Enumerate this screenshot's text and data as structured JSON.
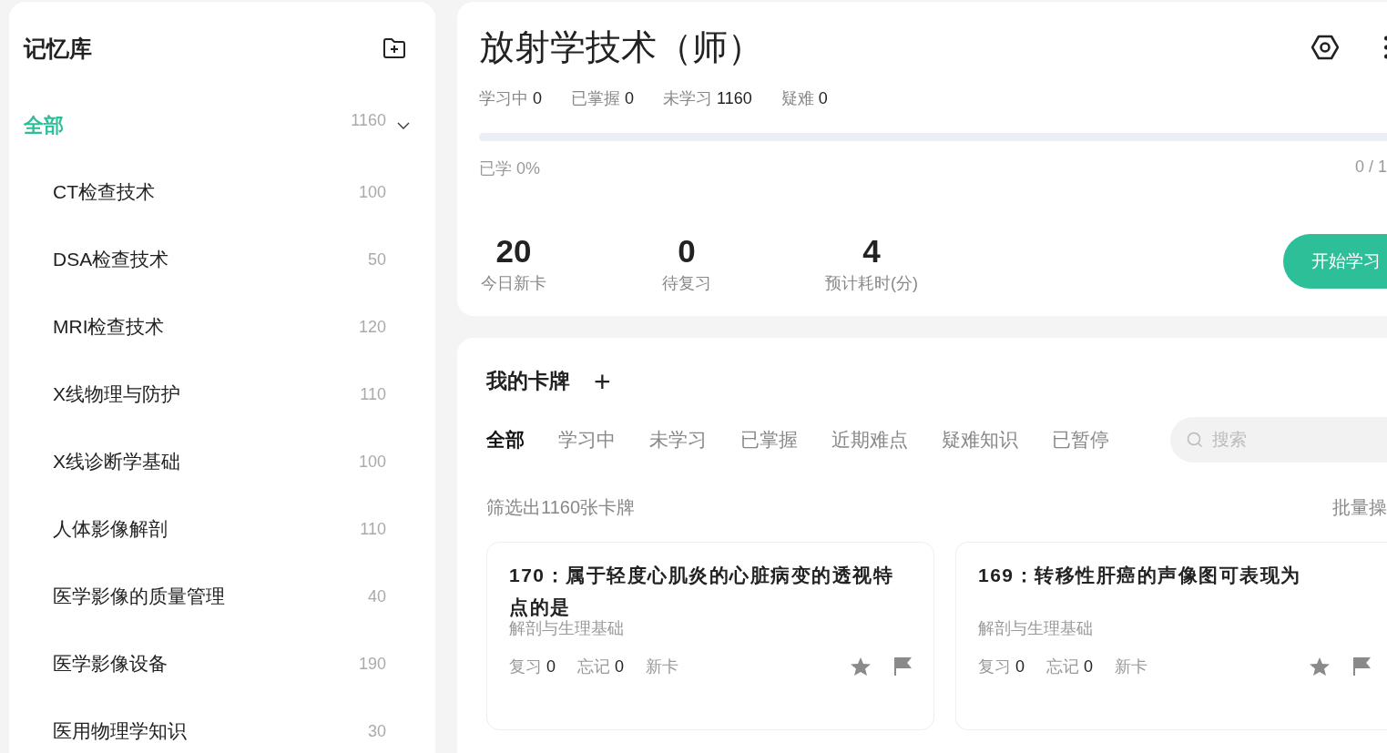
{
  "sidebar": {
    "title": "记忆库",
    "root": {
      "label": "全部",
      "count": "1160",
      "selected": true,
      "expanded": true,
      "children": [
        {
          "label": "CT检查技术",
          "count": "100",
          "selected": false
        },
        {
          "label": "DSA检查技术",
          "count": "50",
          "selected": false
        },
        {
          "label": "MRI检查技术",
          "count": "120",
          "selected": false
        },
        {
          "label": "X线物理与防护",
          "count": "110",
          "selected": false
        },
        {
          "label": "X线诊断学基础",
          "count": "100",
          "selected": false
        },
        {
          "label": "人体影像解剖",
          "count": "110",
          "selected": false
        },
        {
          "label": "医学影像的质量管理",
          "count": "40",
          "selected": false
        },
        {
          "label": "医学影像设备",
          "count": "190",
          "selected": false
        },
        {
          "label": "医用物理学知识",
          "count": "30",
          "selected": false
        }
      ]
    }
  },
  "deck": {
    "title": "放射学技术（师）",
    "stats": [
      {
        "label": "学习中",
        "value": "0"
      },
      {
        "label": "已掌握",
        "value": "0"
      },
      {
        "label": "未学习",
        "value": "1160"
      },
      {
        "label": "疑难",
        "value": "0"
      }
    ],
    "progress": {
      "level": 0,
      "label": "已学 0%",
      "count": "0 / 1"
    },
    "today": [
      {
        "value": "20",
        "label": "今日新卡"
      },
      {
        "value": "0",
        "label": "待复习"
      },
      {
        "value": "4",
        "label": "预计耗时(分)"
      }
    ],
    "start_button": "开始学习"
  },
  "cards_panel": {
    "title": "我的卡牌",
    "add": "+",
    "tabs": [
      {
        "label": "全部",
        "selected": true
      },
      {
        "label": "学习中",
        "selected": false
      },
      {
        "label": "未学习",
        "selected": false
      },
      {
        "label": "已掌握",
        "selected": false
      },
      {
        "label": "近期难点",
        "selected": false
      },
      {
        "label": "疑难知识",
        "selected": false
      },
      {
        "label": "已暂停",
        "selected": false
      }
    ],
    "search": {
      "placeholder": "搜索"
    },
    "filter_text": "筛选出1160张卡牌",
    "batch": "批量操",
    "cards": [
      {
        "title": "170：属于轻度心肌炎的心脏病变的透视特点的是",
        "category": "解剖与生理基础",
        "review": "复习",
        "review_count": "0",
        "forget": "忘记",
        "forget_count": "0",
        "status": "新卡",
        "starred": false,
        "flagged": false
      },
      {
        "title": "169：转移性肝癌的声像图可表现为",
        "category": "解剖与生理基础",
        "review": "复习",
        "review_count": "0",
        "forget": "忘记",
        "forget_count": "0",
        "status": "新卡",
        "starred": false,
        "flagged": false
      }
    ]
  }
}
